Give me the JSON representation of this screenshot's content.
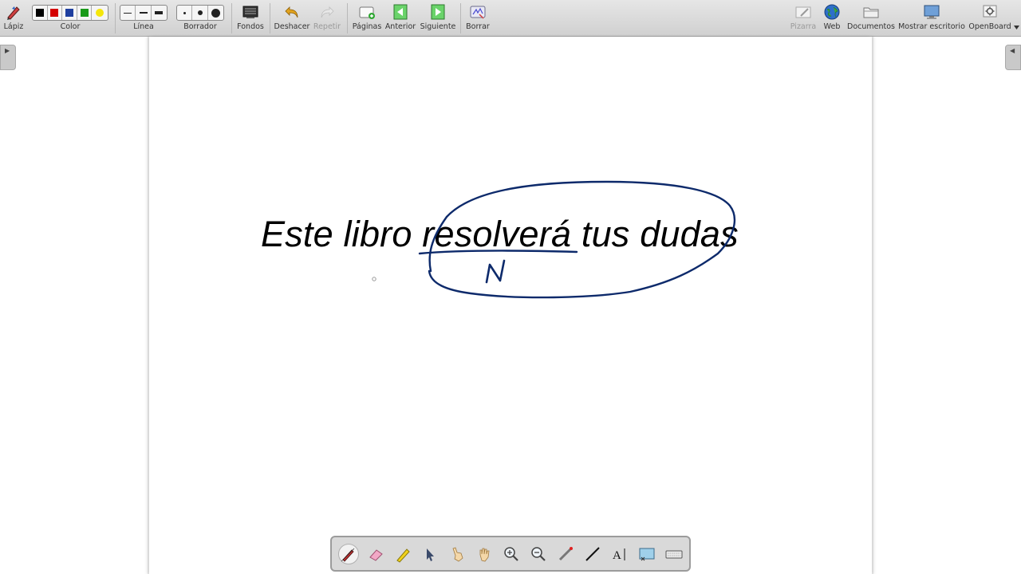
{
  "toolbar": {
    "pencil_label": "Lápiz",
    "color_label": "Color",
    "line_label": "Línea",
    "eraser_label": "Borrador",
    "backgrounds_label": "Fondos",
    "undo_label": "Deshacer",
    "redo_label": "Repetir",
    "pages_label": "Páginas",
    "previous_label": "Anterior",
    "next_label": "Siguiente",
    "clear_label": "Borrar",
    "board_label": "Pizarra",
    "web_label": "Web",
    "documents_label": "Documentos",
    "show_desktop_label": "Mostrar escritorio",
    "openboard_label": "OpenBoard",
    "colors": [
      "#000000",
      "#d40000",
      "#1f3f9f",
      "#1a9a1a",
      "#f5e60a"
    ]
  },
  "board": {
    "text": "Este libro resolverá tus dudas",
    "ink_color": "#0d2a6b",
    "handwritten_letter": "N"
  },
  "palette": {
    "tools": [
      "pen-icon",
      "eraser-icon",
      "highlighter-icon",
      "selector-icon",
      "interactor-icon",
      "hand-icon",
      "zoom-in-icon",
      "zoom-out-icon",
      "laser-pointer-icon",
      "line-icon",
      "text-icon",
      "capture-icon",
      "keyboard-icon"
    ],
    "active_tool": "pen-icon"
  }
}
